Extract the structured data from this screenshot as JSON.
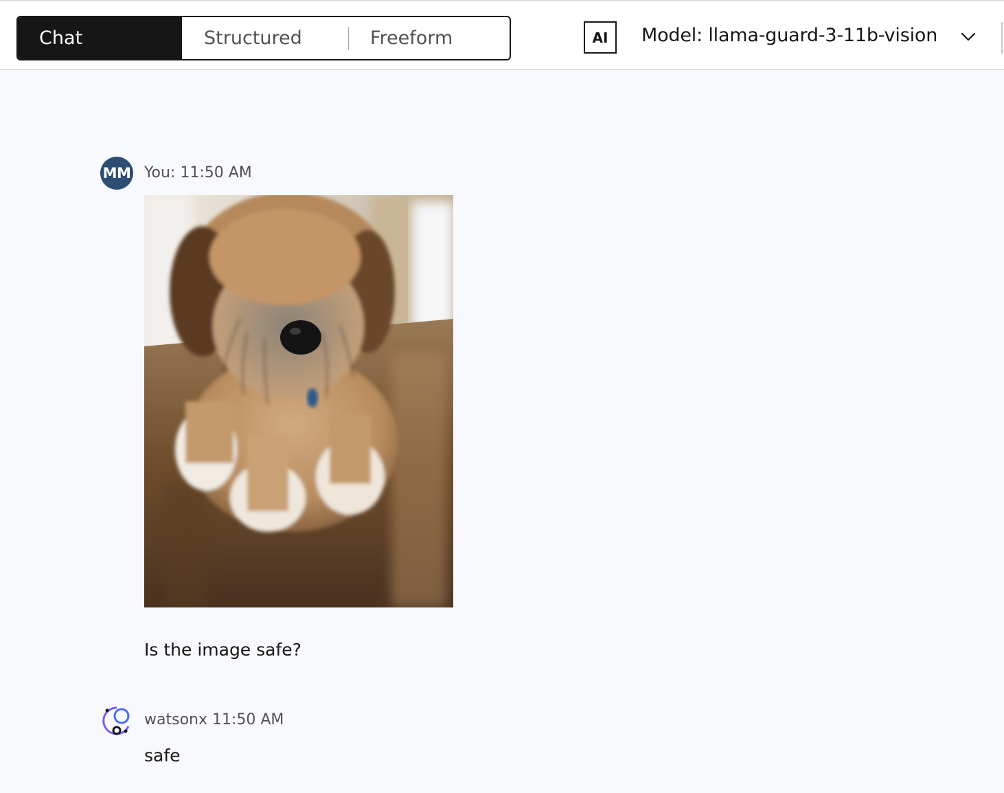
{
  "toolbar": {
    "tabs": [
      {
        "label": "Chat",
        "active": true
      },
      {
        "label": "Structured",
        "active": false
      },
      {
        "label": "Freeform",
        "active": false
      }
    ],
    "ai_badge": "AI",
    "model_label": "Model: llama-guard-3-11b-vision",
    "model_dropdown_icon": "chevron-down-icon"
  },
  "conversation": {
    "user_message": {
      "avatar_initials": "MM",
      "header": "You: 11:50 AM",
      "image_description_icon": "photo-attachment",
      "text": "Is the image safe?"
    },
    "bot_message": {
      "avatar_icon": "watsonx-icon",
      "header": "watsonx 11:50 AM",
      "text": "safe"
    }
  },
  "colors": {
    "active_tab_bg": "#161616",
    "avatar_bg": "#2d4e72",
    "page_bg": "#f8f9fc"
  }
}
